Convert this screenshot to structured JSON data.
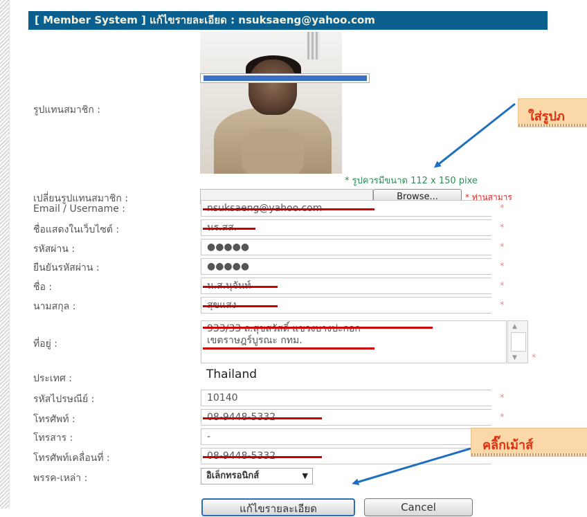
{
  "header": {
    "title": "[ Member System ] แก้ไขรายละเอียด : nsuksaeng@yahoo.com"
  },
  "labels": {
    "avatar": "รูปแทนสมาชิก :",
    "change_avatar": "เปลี่ยนรูปแทนสมาชิก :",
    "email": "Email / Username :",
    "display_name": "ชื่อแสดงในเว็บไซต์ :",
    "password": "รหัสผ่าน :",
    "confirm_password": "ยืนยันรหัสผ่าน :",
    "first_name": "ชื่อ :",
    "last_name": "นามสกุล :",
    "address": "ที่อยู่ :",
    "country": "ประเทศ :",
    "postcode": "รหัสไปรษณีย์ :",
    "phone": "โทรศัพท์ :",
    "fax": "โทรสาร :",
    "mobile": "โทรศัพท์เคลื่อนที่ :",
    "zodiac": "พรรค-เหล่า :"
  },
  "values": {
    "email": "nsuksaeng@yahoo.com",
    "display_name": "นร.สส.",
    "password": "●●●●●",
    "confirm_password": "●●●●●",
    "first_name": "น.ส.นุจันท์",
    "last_name": "สุขแสง",
    "address_line1": "933/33 ถ.สุขสวัสดิ์ แขวงบางปะกอก",
    "address_line2": "เขตราษฎร์บูรณะ กทม.",
    "country": "Thailand",
    "postcode": "10140",
    "phone": "08-9448-5332",
    "fax": "-",
    "mobile": "08-9448-5332",
    "zodiac": "อิเล็กทรอนิกส์"
  },
  "notes": {
    "image_size": "* รูปควรมีขนาด 112 x 150 pixe",
    "browse_hint": "* ท่านสามาร",
    "required": "*"
  },
  "buttons": {
    "browse": "Browse...",
    "save": "แก้ไขรายละเอียด",
    "cancel": "Cancel"
  },
  "callouts": {
    "image": "ใส่รูปภ",
    "click": "คลิ๊กเม้าส์"
  },
  "colors": {
    "header_bg": "#0b5f8f",
    "header_text": "#f5f0d8",
    "redaction": "#cc0000",
    "callout_bg": "#fbd8a8",
    "callout_text": "#e03010",
    "arrow": "#1e6fc0"
  }
}
